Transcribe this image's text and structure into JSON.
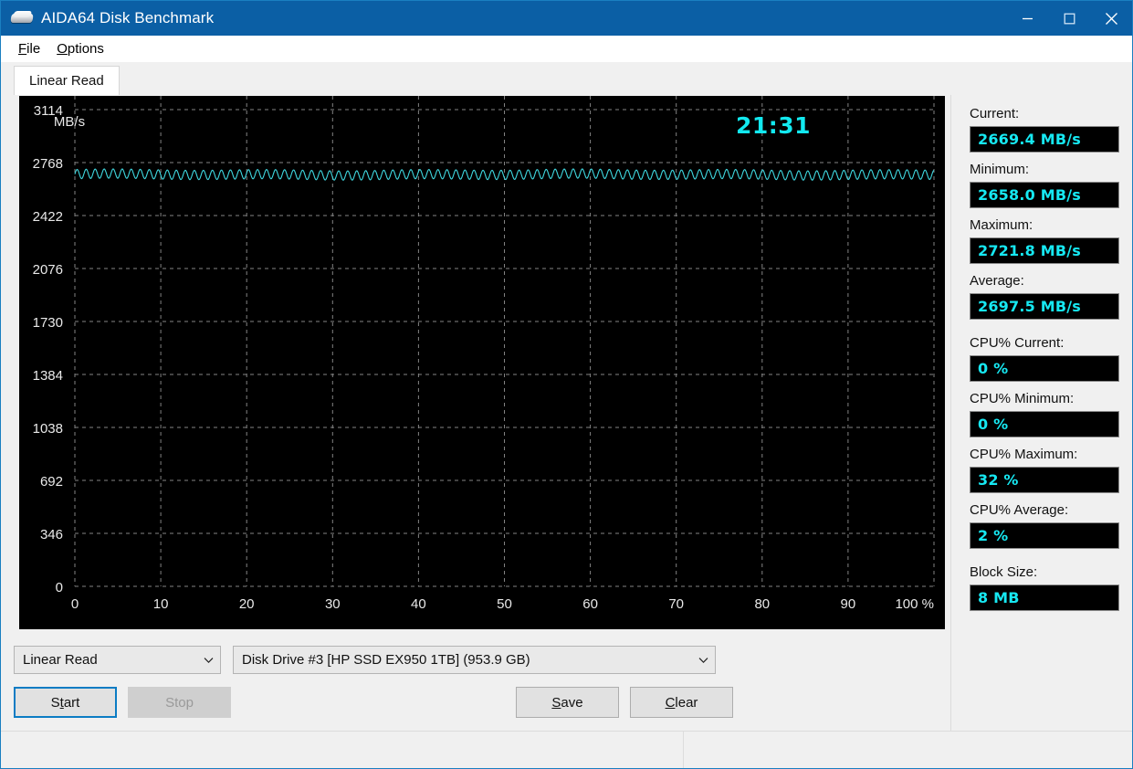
{
  "window": {
    "title": "AIDA64 Disk Benchmark",
    "icon": "disk-drive-icon",
    "accent_color": "#0b5fa5",
    "controls": {
      "minimize": "minimize-icon",
      "maximize": "maximize-icon",
      "close": "close-icon"
    }
  },
  "menu": {
    "items": [
      {
        "label": "File",
        "accel": "F"
      },
      {
        "label": "Options",
        "accel": "O"
      }
    ]
  },
  "tabs": [
    {
      "label": "Linear Read",
      "active": true
    }
  ],
  "chart_data": {
    "type": "line",
    "title": "",
    "xlabel": "",
    "ylabel": "MB/s",
    "x_unit": "%",
    "x_tick_labels": [
      "0",
      "10",
      "20",
      "30",
      "40",
      "50",
      "60",
      "70",
      "80",
      "90",
      "100 %"
    ],
    "x_ticks": [
      0,
      10,
      20,
      30,
      40,
      50,
      60,
      70,
      80,
      90,
      100
    ],
    "xlim": [
      0,
      100
    ],
    "y_tick_labels": [
      "3114",
      "2768",
      "2422",
      "2076",
      "1730",
      "1384",
      "1038",
      "692",
      "346",
      "0"
    ],
    "y_ticks": [
      3114,
      2768,
      2422,
      2076,
      1730,
      1384,
      1038,
      692,
      346,
      0
    ],
    "ylim": [
      0,
      3114
    ],
    "grid": true,
    "background": "#000000",
    "grid_color": "#9b9b9b",
    "line_color": "#3fd8e0",
    "series": [
      {
        "name": "Linear Read",
        "mean": 2697.5,
        "min": 2658.0,
        "max": 2721.8,
        "oscillation_period_pct": 1.05,
        "description": "Dense sawtooth oscillation between 2658 and 2722 MB/s across 0-100% of the drive"
      }
    ],
    "annotations": [
      {
        "name": "elapsed-time",
        "text": "21:31",
        "color": "#12e9f0"
      }
    ]
  },
  "selectors": {
    "mode": {
      "value": "Linear Read",
      "caret": "chevron-down-icon"
    },
    "disk": {
      "value": "Disk Drive #3  [HP SSD EX950 1TB]  (953.9 GB)",
      "caret": "chevron-down-icon"
    }
  },
  "buttons": {
    "start": {
      "label": "Start",
      "accel": "t",
      "enabled": true,
      "focused": true
    },
    "stop": {
      "label": "Stop",
      "enabled": false
    },
    "save": {
      "label": "Save",
      "accel": "S",
      "enabled": true
    },
    "clear": {
      "label": "Clear",
      "accel": "C",
      "enabled": true
    }
  },
  "stats": [
    {
      "label": "Current:",
      "value": "2669.4 MB/s"
    },
    {
      "label": "Minimum:",
      "value": "2658.0 MB/s"
    },
    {
      "label": "Maximum:",
      "value": "2721.8 MB/s"
    },
    {
      "label": "Average:",
      "value": "2697.5 MB/s"
    },
    {
      "label": "CPU% Current:",
      "value": "0 %"
    },
    {
      "label": "CPU% Minimum:",
      "value": "0 %"
    },
    {
      "label": "CPU% Maximum:",
      "value": "32 %"
    },
    {
      "label": "CPU% Average:",
      "value": "2 %"
    },
    {
      "label": "Block Size:",
      "value": "8 MB"
    }
  ],
  "statusbar": {
    "pane1": "",
    "pane2": ""
  }
}
